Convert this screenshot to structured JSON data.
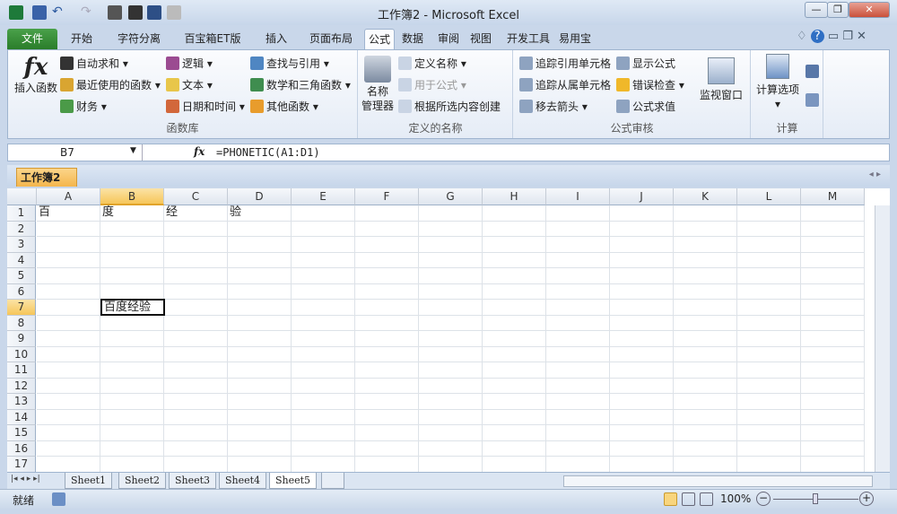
{
  "window": {
    "title": "工作簿2  -  Microsoft Excel",
    "minimize": "—",
    "restore": "❐",
    "close": "✕"
  },
  "quick_access": [
    "excel-logo",
    "save",
    "undo",
    "redo",
    "camera",
    "sort",
    "form",
    "more"
  ],
  "tabs": [
    {
      "label": "文件"
    },
    {
      "label": "开始"
    },
    {
      "label": "字符分离"
    },
    {
      "label": "百宝箱ET版"
    },
    {
      "label": "插入"
    },
    {
      "label": "页面布局"
    },
    {
      "label": "公式"
    },
    {
      "label": "数据"
    },
    {
      "label": "审阅"
    },
    {
      "label": "视图"
    },
    {
      "label": "开发工具"
    },
    {
      "label": "易用宝"
    }
  ],
  "ribbon": {
    "function_library": {
      "label": "函数库",
      "insert": "插入函数",
      "fx": "fx",
      "items": [
        {
          "label": "自动求和 ▾",
          "color": "#333"
        },
        {
          "label": "最近使用的函数 ▾",
          "color": "#d9a531"
        },
        {
          "label": "财务 ▾",
          "color": "#4b9a48"
        },
        {
          "label": "逻辑 ▾",
          "color": "#9b4b91"
        },
        {
          "label": "文本 ▾",
          "color": "#e8c64a"
        },
        {
          "label": "日期和时间 ▾",
          "color": "#d2673b"
        },
        {
          "label": "查找与引用 ▾",
          "color": "#4f86c2"
        },
        {
          "label": "数学和三角函数 ▾",
          "color": "#3f8d4f"
        },
        {
          "label": "其他函数 ▾",
          "color": "#e89c2c"
        }
      ]
    },
    "defined_names": {
      "label": "定义的名称",
      "manager": "名称\n管理器",
      "items": [
        {
          "label": "定义名称 ▾"
        },
        {
          "label": "用于公式 ▾"
        },
        {
          "label": "根据所选内容创建"
        }
      ]
    },
    "formula_auditing": {
      "label": "公式审核",
      "items": [
        {
          "label": "追踪引用单元格"
        },
        {
          "label": "追踪从属单元格"
        },
        {
          "label": "移去箭头 ▾"
        },
        {
          "label": "显示公式"
        },
        {
          "label": "错误检查 ▾"
        },
        {
          "label": "公式求值"
        }
      ],
      "watch": "监视窗口"
    },
    "calculation": {
      "label": "计算",
      "options": "计算选项",
      "arrow": "▾"
    }
  },
  "formula_bar": {
    "name_box": "B7",
    "fx": "fx",
    "formula": "=PHONETIC(A1:D1)"
  },
  "workbook_tab": "工作簿2",
  "grid": {
    "columns": [
      "A",
      "B",
      "C",
      "D",
      "E",
      "F",
      "G",
      "H",
      "I",
      "J",
      "K",
      "L",
      "M"
    ],
    "rows": [
      "1",
      "2",
      "3",
      "4",
      "5",
      "6",
      "7",
      "8",
      "9",
      "10",
      "11",
      "12",
      "13",
      "14",
      "15",
      "16",
      "17"
    ],
    "selected_col": "B",
    "selected_row": "7",
    "cells": [
      {
        "ref": "A1",
        "value": "百"
      },
      {
        "ref": "B1",
        "value": "度"
      },
      {
        "ref": "C1",
        "value": "经"
      },
      {
        "ref": "D1",
        "value": "验"
      },
      {
        "ref": "B7",
        "value": "百度经验"
      }
    ]
  },
  "sheets": [
    {
      "label": "Sheet1"
    },
    {
      "label": "Sheet2"
    },
    {
      "label": "Sheet3"
    },
    {
      "label": "Sheet4"
    },
    {
      "label": "Sheet5",
      "active": true
    }
  ],
  "status": {
    "ready": "就绪",
    "zoom": "100%",
    "minus": "−",
    "plus": "+"
  }
}
